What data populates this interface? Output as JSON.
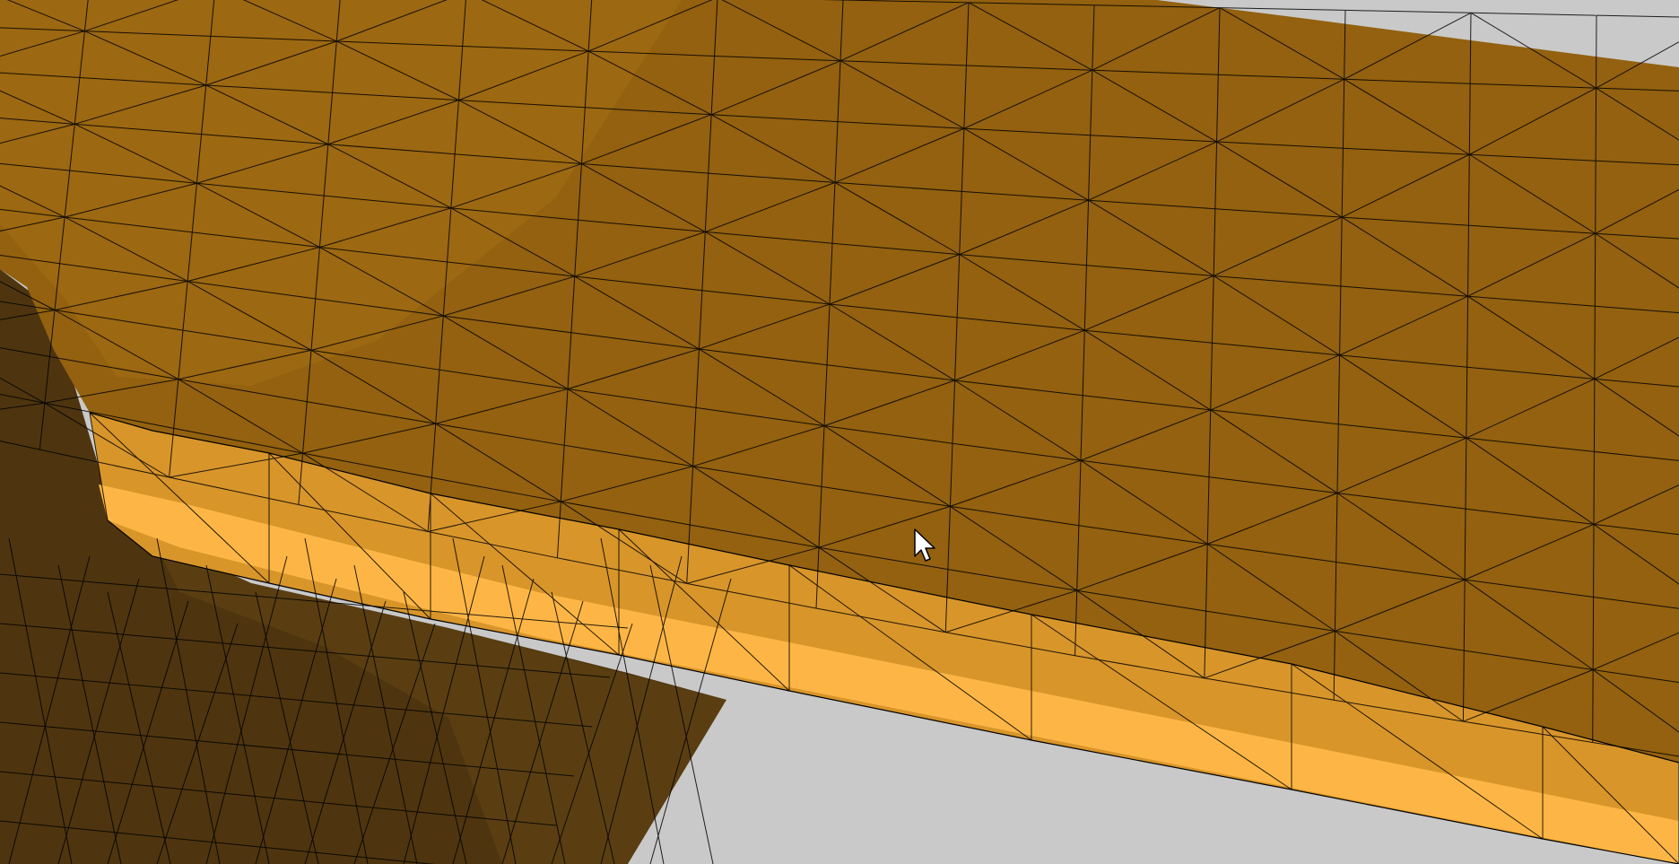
{
  "viewport": {
    "kind": "3d-mesh-render",
    "background_color": "#c9c9c9",
    "mesh_edge_color": "#000000",
    "colors": {
      "top_face": "#93610f",
      "top_face_light": "#a06b12",
      "side_band": "#d8952a",
      "side_band_bright": "#fdb646",
      "lower_body": "#4e350f",
      "lower_body_light": "#5a3e12",
      "corner_fill": "#6e4a10"
    }
  },
  "cursor": {
    "icon": "arrow-cursor-icon"
  }
}
